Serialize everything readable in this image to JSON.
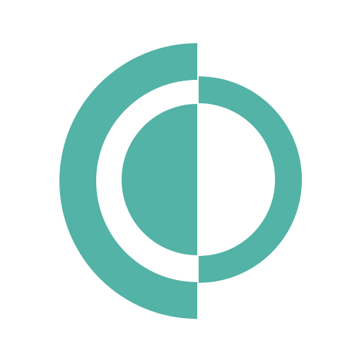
{
  "logo": {
    "icon": "split-circle-logo-icon",
    "colors": {
      "background": "#ffffff",
      "brand": "#52b3a6"
    }
  }
}
